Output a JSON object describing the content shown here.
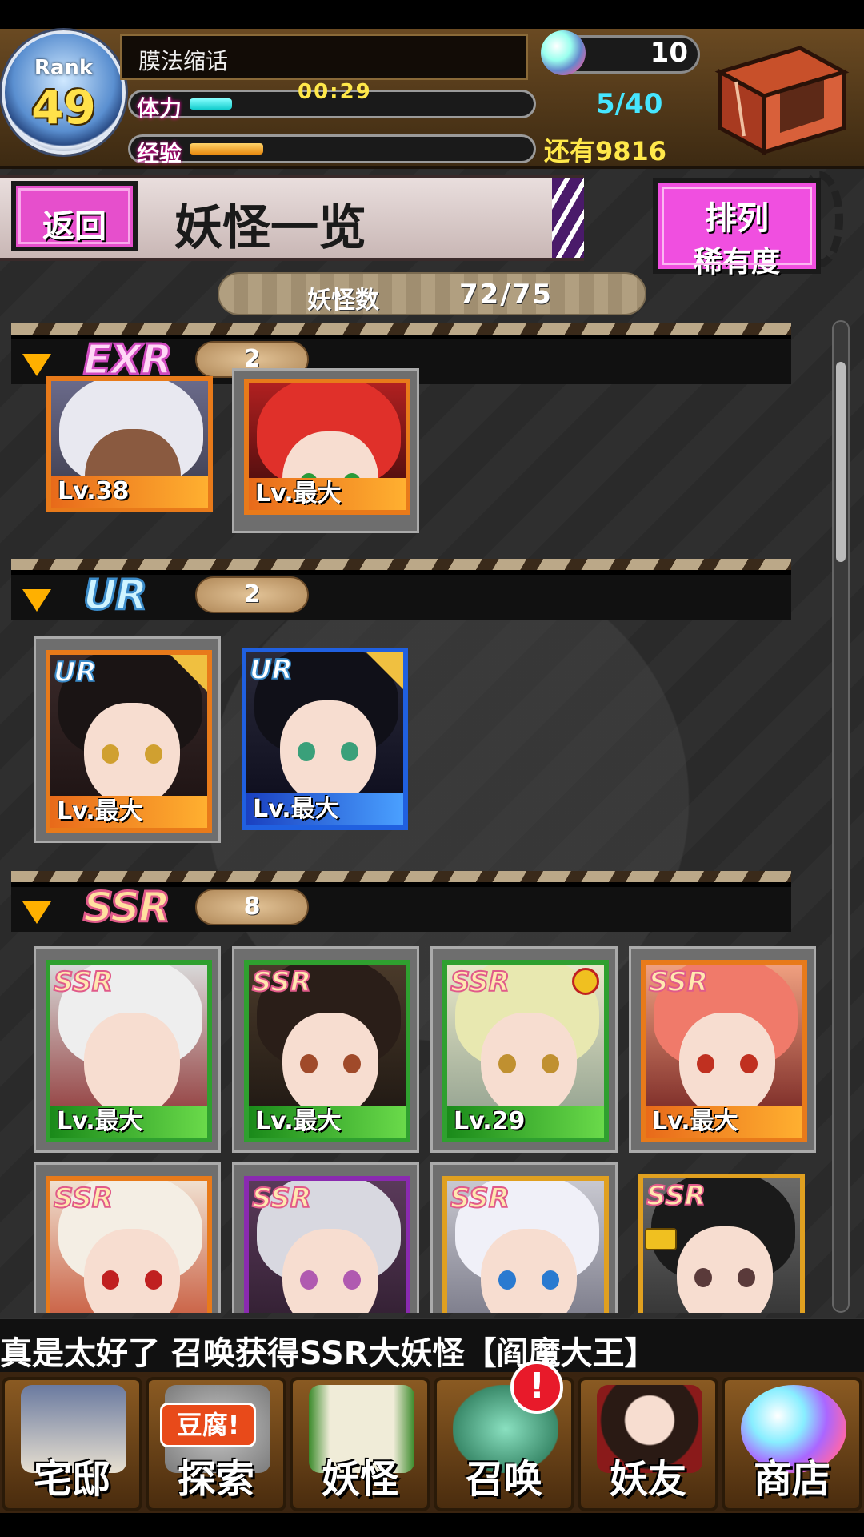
{
  "header": {
    "rank_label": "Rank",
    "rank_value": "49",
    "player_name": "膜法缩话",
    "stamina_label": "体力",
    "stamina_timer": "00:29",
    "stamina_count": "5/40",
    "stamina_fill_fraction": 0.125,
    "exp_label": "经验",
    "exp_fill_fraction": 0.22,
    "exp_remaining": "还有9816",
    "orb_count": "10"
  },
  "toolbar": {
    "back_label": "返回",
    "title": "妖怪一览",
    "sort_line1": "排列",
    "sort_line2": "稀有度"
  },
  "summary": {
    "count_label": "妖怪数",
    "count_value": "72/75"
  },
  "sections": [
    {
      "rarity": "EXR",
      "count": "2",
      "cards": [
        {
          "level": "Lv.38",
          "frame": "orange"
        },
        {
          "level": "Lv.最大",
          "frame": "orange"
        }
      ]
    },
    {
      "rarity": "UR",
      "count": "2",
      "cards": [
        {
          "badge": "UR",
          "level": "Lv.最大",
          "frame": "orange"
        },
        {
          "badge": "UR",
          "level": "Lv.最大",
          "frame": "blue"
        }
      ]
    },
    {
      "rarity": "SSR",
      "count": "8",
      "cards": [
        {
          "badge": "SSR",
          "level": "Lv.最大",
          "frame": "green"
        },
        {
          "badge": "SSR",
          "level": "Lv.最大",
          "frame": "green"
        },
        {
          "badge": "SSR",
          "level": "Lv.29",
          "frame": "green"
        },
        {
          "badge": "SSR",
          "level": "Lv.最大",
          "frame": "orange"
        },
        {
          "badge": "SSR",
          "level": "",
          "frame": "orange"
        },
        {
          "badge": "SSR",
          "level": "",
          "frame": "purple"
        },
        {
          "badge": "SSR",
          "level": "",
          "frame": "gold"
        },
        {
          "badge": "SSR",
          "level": "",
          "frame": "gold"
        }
      ]
    }
  ],
  "ticker": "真是太好了 召唤获得SSR大妖怪【阎魔大王】",
  "nav": [
    {
      "label": "宅邸",
      "icon": "mansion-icon"
    },
    {
      "label": "探索",
      "icon": "explore-icon",
      "badge": "豆腐!"
    },
    {
      "label": "妖怪",
      "icon": "yokai-scroll-icon"
    },
    {
      "label": "召唤",
      "icon": "pentagram-icon",
      "alert": "!"
    },
    {
      "label": "妖友",
      "icon": "friend-icon"
    },
    {
      "label": "商店",
      "icon": "shop-orb-icon"
    }
  ],
  "colors": {
    "accent_pink": "#e64fcc",
    "stamina_cyan": "#46e6ff",
    "exp_gold": "#ffe84a"
  }
}
